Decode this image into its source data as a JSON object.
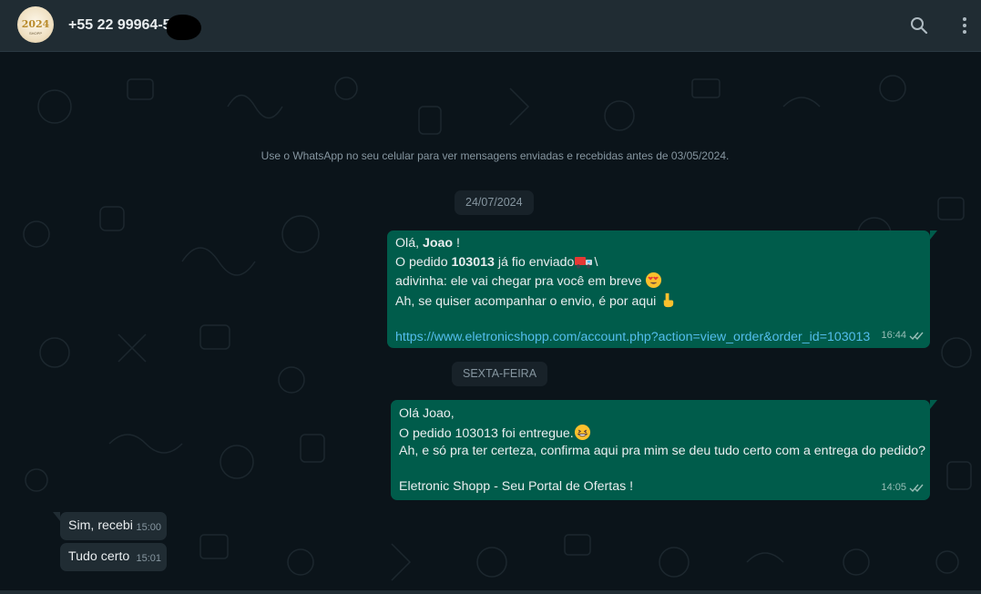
{
  "header": {
    "contact_name": "+55 22 99964-57",
    "avatar_logo_text": "2024",
    "avatar_logo_sub": "SHOPP",
    "search_icon": "search-icon",
    "menu_icon": "kebab-menu-icon"
  },
  "chat": {
    "system_note": "Use o WhatsApp no seu celular para ver mensagens enviadas e recebidas antes de 03/05/2024.",
    "date_pill_1": "24/07/2024",
    "date_pill_2": "SEXTA-FEIRA",
    "message_1": {
      "greeting_prefix": "Olá, ",
      "greeting_name": "Joao",
      "greeting_suffix": " !",
      "order_prefix": "O pedido ",
      "order_number": "103013",
      "order_suffix": " já fio enviado",
      "order_tail": "\\",
      "line_3": "adivinha: ele vai chegar pra você em breve ",
      "line_4": "Ah, se quiser acompanhar o envio, é por aqui ",
      "link": "https://www.eletronicshopp.com/account.php?action=view_order&order_id=103013",
      "time": "16:44",
      "status": "read"
    },
    "message_2": {
      "line_1": "Olá Joao,",
      "line_2": "O pedido 103013 foi entregue.",
      "line_3": "Ah, e só pra ter certeza, confirma aqui pra mim se deu tudo certo com a entrega do pedido?",
      "line_4": "Eletronic Shopp - Seu Portal de Ofertas !",
      "time": "14:05",
      "status": "read"
    },
    "message_3": {
      "text": "Sim, recebi",
      "time": "15:00"
    },
    "message_4": {
      "text": "Tudo certo",
      "time": "15:01"
    }
  },
  "colors": {
    "background": "#0b141a",
    "header": "#202c33",
    "outgoing_bubble": "#005c4b",
    "incoming_bubble": "#202c33",
    "link": "#53bdeb",
    "muted_text": "#8696a0"
  }
}
